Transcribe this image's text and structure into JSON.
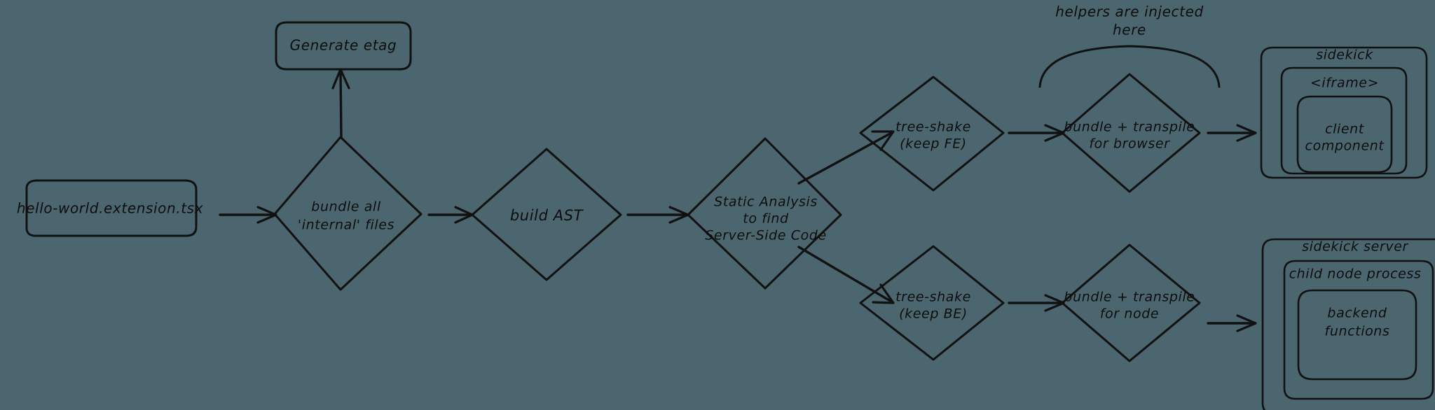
{
  "diagram": {
    "title": "extension build pipeline",
    "style": "hand-drawn flowchart",
    "background_color": "#4c666f",
    "stroke_color": "#111111",
    "nodes": [
      {
        "id": "source",
        "shape": "rounded-rect",
        "lines": [
          "hello-world.extension.tsx"
        ]
      },
      {
        "id": "generate-etag",
        "shape": "rounded-rect",
        "lines": [
          "Generate etag"
        ]
      },
      {
        "id": "bundle-internal",
        "shape": "diamond",
        "lines": [
          "bundle all",
          "'internal' files"
        ]
      },
      {
        "id": "build-ast",
        "shape": "diamond",
        "lines": [
          "build AST"
        ]
      },
      {
        "id": "static-analysis",
        "shape": "diamond",
        "lines": [
          "Static Analysis",
          "to find",
          "Server-Side Code"
        ]
      },
      {
        "id": "treeshake-fe",
        "shape": "diamond",
        "lines": [
          "tree-shake",
          "(keep FE)"
        ]
      },
      {
        "id": "treeshake-be",
        "shape": "diamond",
        "lines": [
          "tree-shake",
          "(keep BE)"
        ]
      },
      {
        "id": "bundle-browser",
        "shape": "diamond",
        "lines": [
          "bundle + transpile",
          "for browser"
        ]
      },
      {
        "id": "bundle-node",
        "shape": "diamond",
        "lines": [
          "bundle + transpile",
          "for node"
        ]
      },
      {
        "id": "sidekick",
        "shape": "rounded-rect",
        "lines": [
          "sidekick"
        ]
      },
      {
        "id": "iframe",
        "shape": "rounded-rect",
        "lines": [
          "<iframe>"
        ]
      },
      {
        "id": "client-component",
        "shape": "rounded-rect",
        "lines": [
          "client",
          "component"
        ]
      },
      {
        "id": "sidekick-server",
        "shape": "rounded-rect",
        "lines": [
          "sidekick server"
        ]
      },
      {
        "id": "child-node-process",
        "shape": "rounded-rect",
        "lines": [
          "child node process"
        ]
      },
      {
        "id": "backend-functions",
        "shape": "rounded-rect",
        "lines": [
          "backend",
          "functions"
        ]
      }
    ],
    "annotations": [
      {
        "id": "helpers-note",
        "lines": [
          "helpers are injected",
          "here"
        ]
      }
    ],
    "edges": [
      {
        "from": "source",
        "to": "bundle-internal",
        "kind": "arrow"
      },
      {
        "from": "bundle-internal",
        "to": "generate-etag",
        "kind": "arrow-up"
      },
      {
        "from": "bundle-internal",
        "to": "build-ast",
        "kind": "arrow"
      },
      {
        "from": "build-ast",
        "to": "static-analysis",
        "kind": "arrow"
      },
      {
        "from": "static-analysis",
        "to": "treeshake-fe",
        "kind": "arrow-diagonal-up"
      },
      {
        "from": "static-analysis",
        "to": "treeshake-be",
        "kind": "arrow-diagonal-down"
      },
      {
        "from": "treeshake-fe",
        "to": "bundle-browser",
        "kind": "arrow"
      },
      {
        "from": "treeshake-be",
        "to": "bundle-node",
        "kind": "arrow"
      },
      {
        "from": "bundle-browser",
        "to": "sidekick",
        "kind": "arrow"
      },
      {
        "from": "bundle-node",
        "to": "sidekick-server",
        "kind": "arrow"
      }
    ]
  },
  "text": {
    "source": "hello-world.extension.tsx",
    "generate_etag": "Generate etag",
    "bundle_internal_1": "bundle all",
    "bundle_internal_2": "'internal' files",
    "build_ast": "build AST",
    "static_analysis_1": "Static Analysis",
    "static_analysis_2": "to find",
    "static_analysis_3": "Server-Side Code",
    "treeshake_fe_1": "tree-shake",
    "treeshake_fe_2": "(keep FE)",
    "treeshake_be_1": "tree-shake",
    "treeshake_be_2": "(keep BE)",
    "bundle_browser_1": "bundle + transpile",
    "bundle_browser_2": "for browser",
    "bundle_node_1": "bundle + transpile",
    "bundle_node_2": "for node",
    "helpers_note_1": "helpers are injected",
    "helpers_note_2": "here",
    "sidekick": "sidekick",
    "iframe": "<iframe>",
    "client_component_1": "client",
    "client_component_2": "component",
    "sidekick_server": "sidekick server",
    "child_node_process": "child node process",
    "backend_functions_1": "backend",
    "backend_functions_2": "functions"
  }
}
